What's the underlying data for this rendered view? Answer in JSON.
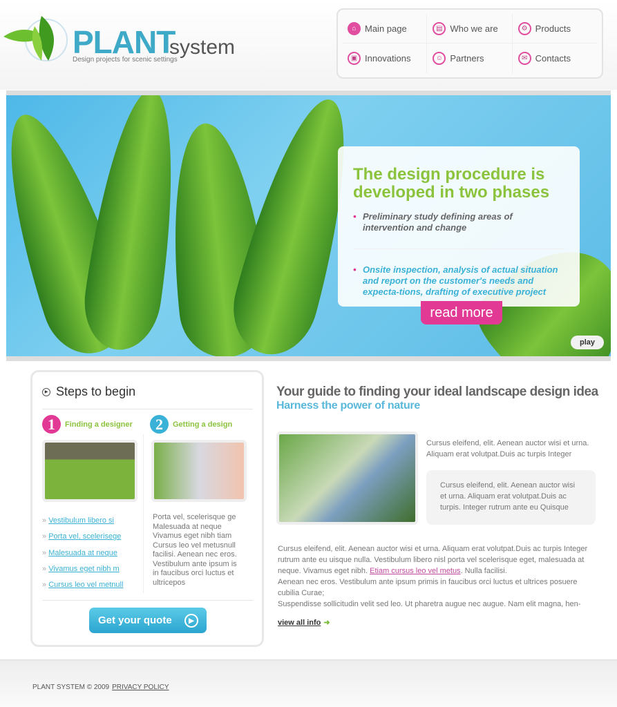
{
  "header": {
    "logo_main": "PLANT",
    "logo_sub": "system",
    "tagline": "Design projects for scenic settings"
  },
  "nav": [
    {
      "label": "Main page",
      "icon": "home-icon",
      "glyph": "⌂"
    },
    {
      "label": "Who we are",
      "icon": "document-icon",
      "glyph": "▤"
    },
    {
      "label": "Products",
      "icon": "gear-icon",
      "glyph": "⚙"
    },
    {
      "label": "Innovations",
      "icon": "briefcase-icon",
      "glyph": "▣"
    },
    {
      "label": "Partners",
      "icon": "people-icon",
      "glyph": "☺"
    },
    {
      "label": "Contacts",
      "icon": "envelope-icon",
      "glyph": "✉"
    }
  ],
  "banner": {
    "title": "The design procedure is developed in two phases",
    "points": [
      "Preliminary study defining areas of intervention and change",
      "Onsite inspection, analysis of actual situation and report on the customer's needs and expecta-tions, drafting of executive project"
    ],
    "read_more": "read more",
    "play": "play"
  },
  "steps": {
    "title": "Steps to begin",
    "step1": {
      "num": "1",
      "title": "Finding a designer",
      "links": [
        "Vestibulum libero si",
        "Porta vel, scelerisege",
        "Malesuada at neque",
        "Vivamus eget nibh m",
        "Cursus leo vel metnull"
      ]
    },
    "step2": {
      "num": "2",
      "title": "Getting a design",
      "text": "Porta vel, scelerisque ge Malesuada at neque Vivamus eget nibh tiam Cursus leo vel metusnull facilisi. Aenean nec eros. Vestibulum ante ipsum is in faucibus orci luctus et ultricepos"
    },
    "quote": "Get your quote"
  },
  "main": {
    "title": "Your guide to finding your ideal landscape design idea",
    "subtitle": "Harness the power of nature",
    "intro": "Cursus eleifend, elit. Aenean auctor wisi et urna. Aliquam erat volutpat.Duis ac turpis Integer",
    "box": "Cursus eleifend, elit. Aenean auctor wisi et urna. Aliquam erat volutpat.Duis ac turpis. Integer rutrum ante eu Quisque",
    "body1": "Cursus eleifend, elit. Aenean auctor wisi et urna. Aliquam erat volutpat.Duis ac turpis Integer rutrum ante eu uisque nulla. Vestibulum libero nisl porta vel scelerisque eget, malesuada at neque. Vivamus eget nibh. ",
    "link": "Etiam cursus leo vel metus",
    "body2": ". Nulla facilisi.",
    "body3": "Aenean nec eros. Vestibulum ante ipsum primis in faucibus orci luctus et ultrices posuere cubilia Curae;",
    "body4": "Suspendisse sollicitudin velit sed leo. Ut pharetra augue nec augue. Nam elit magna, hen-",
    "view_all": "view all info"
  },
  "footer": {
    "copyright": "PLANT SYSTEM © 2009",
    "privacy": "PRIVACY POLICY"
  },
  "colors": {
    "accent_pink": "#e23a94",
    "accent_green": "#8bc33d",
    "accent_blue": "#3ab1d6"
  }
}
